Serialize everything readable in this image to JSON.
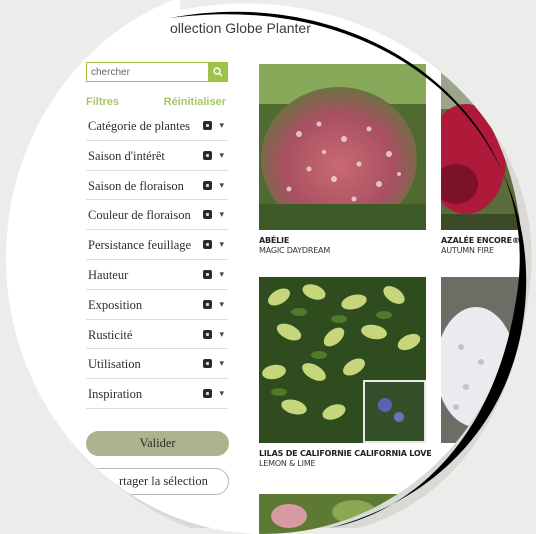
{
  "header": {
    "title": "ollection Globe Planter"
  },
  "search": {
    "placeholder": "chercher",
    "icon": "search-icon"
  },
  "filters": {
    "heading": "Filtres",
    "reset_label": "Réinitialiser",
    "items": [
      {
        "label": "Catégorie de plantes"
      },
      {
        "label": "Saison d'intérêt"
      },
      {
        "label": "Saison de floraison"
      },
      {
        "label": "Couleur de floraison"
      },
      {
        "label": "Persistance feuillage"
      },
      {
        "label": "Hauteur"
      },
      {
        "label": "Exposition"
      },
      {
        "label": "Rusticité"
      },
      {
        "label": "Utilisation"
      },
      {
        "label": "Inspiration"
      }
    ],
    "help_icon": "question-icon",
    "chevron_icon": "chevron-down-icon"
  },
  "actions": {
    "validate_label": "Valider",
    "share_label": "rtager la sélection"
  },
  "products": [
    {
      "name": "ABÉLIE",
      "cultivar": "MAGIC DAYDREAM"
    },
    {
      "name": "AZALÉE ENCORE®",
      "cultivar": "AUTUMN FIRE"
    },
    {
      "name": "LILAS DE CALIFORNIE  CALIFORNIA LOVE",
      "cultivar": "LEMON & LIME"
    }
  ],
  "colors": {
    "accent": "#9fc24a",
    "button": "#acb38f",
    "frame": "#000000",
    "background": "#ececea"
  }
}
